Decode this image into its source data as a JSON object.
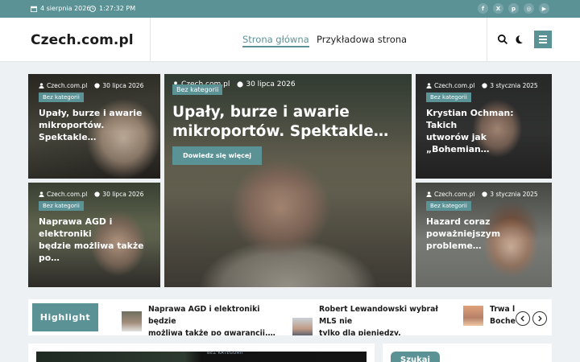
{
  "topbar": {
    "date": "4 sierpnia 2026",
    "time": "1:27:32 PM",
    "social": [
      {
        "icon": "facebook-icon",
        "glyph": "f"
      },
      {
        "icon": "x-twitter-icon",
        "glyph": "X"
      },
      {
        "icon": "pinterest-icon",
        "glyph": "p"
      },
      {
        "icon": "instagram-icon",
        "glyph": "◎"
      },
      {
        "icon": "youtube-icon",
        "glyph": "▶"
      }
    ]
  },
  "header": {
    "logo": "Czech.com.pl",
    "nav": {
      "home": "Strona główna",
      "sample": "Przykładowa strona"
    }
  },
  "colors": {
    "accent": "#5b9296",
    "topbar": "#5b9296",
    "text": "#1b1b1b"
  },
  "cards": [
    {
      "author": "Czech.com.pl",
      "date": "30 lipca 2026",
      "category": "Bez kategorii",
      "title": "Upały, burze i awarie\nmikroportów. Spektakle…"
    },
    {
      "author": "Czech.com.pl",
      "date": "30 lipca 2026",
      "category": "Bez kategorii",
      "title": "Naprawa AGD i elektroniki\nbędzie możliwa także po…"
    },
    {
      "author": "Czech.com.pl",
      "date": "30 lipca 2026",
      "category": "Bez kategorii",
      "title": "Upały, burze i awarie\nmikroportów. Spektakle…",
      "more": "Dowiedz się więcej"
    },
    {
      "author": "Czech.com.pl",
      "date": "3 stycznia 2025",
      "category": "Bez kategorii",
      "title": "Krystian Ochman: Takich\nutworów jak „Bohemian…"
    },
    {
      "author": "Czech.com.pl",
      "date": "3 stycznia 2025",
      "category": "Bez kategorii",
      "title": "Hazard coraz\npoważniejszym probleme…"
    }
  ],
  "highlight": {
    "label": "Highlight",
    "items": [
      {
        "title": "Naprawa AGD i elektroniki będzie\nmożliwa także po gwarancji.…"
      },
      {
        "title": "Robert Lewandowski wybrał MLS nie\ntylko dla pieniędzy. Amerykański…"
      },
      {
        "title": "Trwa l\nBoche"
      }
    ]
  },
  "bottom": {
    "search_label": "Szukaj",
    "tiny_category": "BEZ KATEGORII"
  }
}
